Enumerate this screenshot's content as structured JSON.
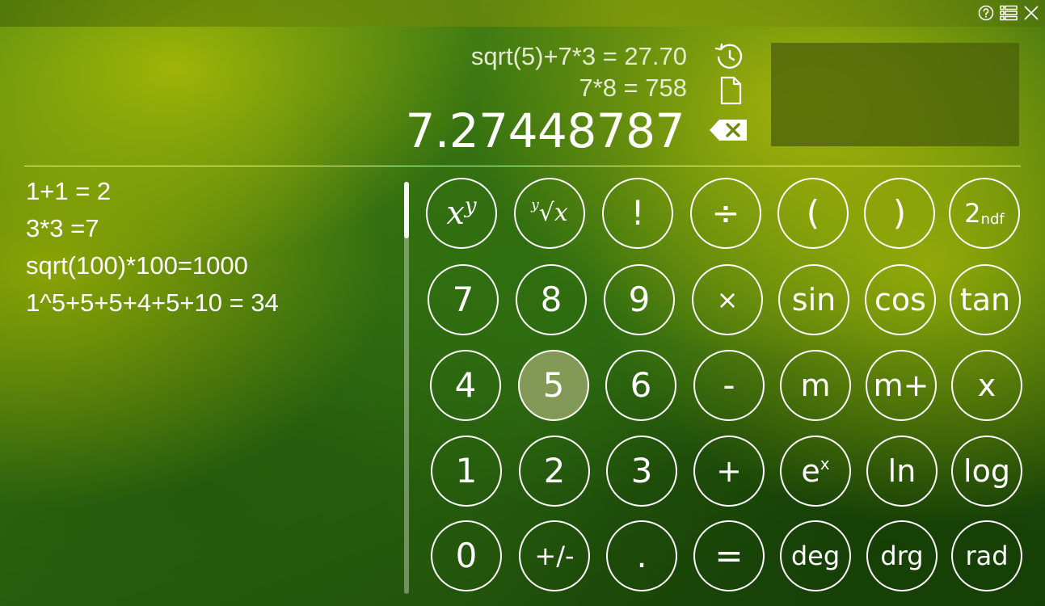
{
  "titlebar": {
    "icons": [
      "help-icon",
      "list-icon",
      "close-icon"
    ]
  },
  "display": {
    "history_line_1": "sqrt(5)+7*3 = 27.70",
    "history_line_2": "7*8 = 758",
    "current_value": "7.27448787",
    "icons": [
      "history-icon",
      "document-icon",
      "backspace-icon"
    ]
  },
  "history": {
    "items": [
      "1+1 = 2",
      "3*3 =7",
      "sqrt(100)*100=1000",
      "1^5+5+5+4+5+10 = 34"
    ]
  },
  "keypad": {
    "rows": [
      [
        "x^y",
        "y√x",
        "!",
        "÷",
        "(",
        ")",
        "2ndf"
      ],
      [
        "7",
        "8",
        "9",
        "×",
        "sin",
        "cos",
        "tan"
      ],
      [
        "4",
        "5",
        "6",
        "-",
        "m",
        "m+",
        "x"
      ],
      [
        "1",
        "2",
        "3",
        "+",
        "ex",
        "ln",
        "log"
      ],
      [
        "0",
        "+/-",
        ".",
        "=",
        "deg",
        "drg",
        "rad"
      ]
    ],
    "labels": {
      "fact": "!",
      "divide": "÷",
      "lparen": "(",
      "rparen": ")",
      "two": "2",
      "ndf": "ndf",
      "seven": "7",
      "eight": "8",
      "nine": "9",
      "multiply": "×",
      "sin": "sin",
      "cos": "cos",
      "tan": "tan",
      "four": "4",
      "five": "5",
      "six": "6",
      "minus": "-",
      "m": "m",
      "mplus": "m+",
      "x": "x",
      "one": "1",
      "twoKey": "2",
      "three": "3",
      "plus": "+",
      "e": "e",
      "ex_sup": "x",
      "ln": "ln",
      "log": "log",
      "zero": "0",
      "plusminus": "+/-",
      "dot": ".",
      "equals": "=",
      "deg": "deg",
      "drg": "drg",
      "rad": "rad",
      "pow_x": "x",
      "pow_y": "y",
      "root_y": "y",
      "root_x": "x"
    },
    "pressed_key": "5"
  },
  "colors": {
    "accent": "#9fb407",
    "text": "#ffffff",
    "pressed_key_fill": "#a0aa6e"
  }
}
